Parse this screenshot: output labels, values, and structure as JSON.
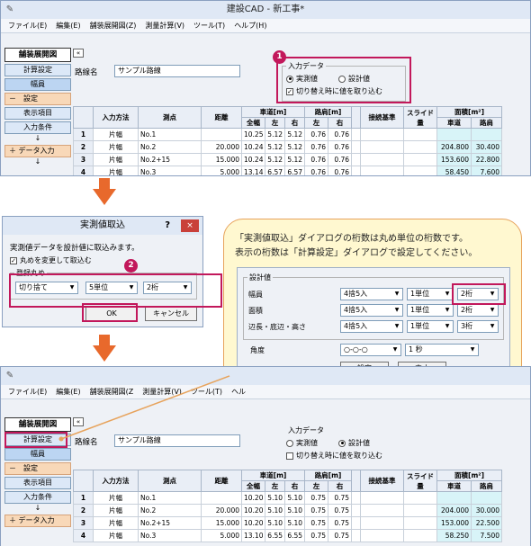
{
  "app": {
    "title": "建設CAD - 新工事*",
    "menus": [
      "ファイル(E)",
      "編集(E)",
      "舗装展開図(Z)",
      "測量計算(V)",
      "ツール(T)",
      "ヘルプ(H)"
    ],
    "bottom_menus": [
      "ファイル(E)",
      "編集(E)",
      "舗装展開図(Z",
      "測量計算(V)",
      "ツール(T)",
      "ヘル"
    ]
  },
  "sidebar": {
    "title": "舗装展開図",
    "items": [
      "計算設定",
      "幅員",
      "－　設定",
      "表示項目",
      "入力条件",
      "↓",
      "＋ データ入力",
      "↓"
    ]
  },
  "form": {
    "road_label": "路線名",
    "road_value": "サンプル路線"
  },
  "input_data_top": {
    "title": "入力データ",
    "opt1": "実測値",
    "opt2": "設計値",
    "checkbox": "切り替え時に値を取り込む",
    "check": "✓"
  },
  "input_data_bottom": {
    "title": "入力データ",
    "opt1": "実測値",
    "opt2": "設計値",
    "checkbox": "切り替え時に値を取り込む",
    "check": ""
  },
  "markers": {
    "one": "1",
    "two": "2"
  },
  "table": {
    "h_method": "入力方法",
    "h_point": "測点",
    "h_dist": "距離",
    "h_road": "車道[m]",
    "h_shoulder": "路肩[m]",
    "h_conn": "接続基準",
    "h_slide": "スライド量",
    "h_area": "面積[m²]",
    "sub": [
      "全幅",
      "左",
      "右",
      "左",
      "右",
      "車道",
      "路肩"
    ]
  },
  "rows_top": [
    {
      "n": "1",
      "m": "片幅",
      "p": "No.1",
      "d": "",
      "w": "10.25",
      "l": "5.12",
      "r": "5.12",
      "sl": "0.76",
      "sr": "0.76",
      "a1": "",
      "a2": ""
    },
    {
      "n": "2",
      "m": "片幅",
      "p": "No.2",
      "d": "20.000",
      "w": "10.24",
      "l": "5.12",
      "r": "5.12",
      "sl": "0.76",
      "sr": "0.76",
      "a1": "204.800",
      "a2": "30.400"
    },
    {
      "n": "3",
      "m": "片幅",
      "p": "No.2+15",
      "d": "15.000",
      "w": "10.24",
      "l": "5.12",
      "r": "5.12",
      "sl": "0.76",
      "sr": "0.76",
      "a1": "153.600",
      "a2": "22.800"
    },
    {
      "n": "4",
      "m": "片幅",
      "p": "No.3",
      "d": "5.000",
      "w": "13.14",
      "l": "6.57",
      "r": "6.57",
      "sl": "0.76",
      "sr": "0.76",
      "a1": "58.450",
      "a2": "7.600"
    }
  ],
  "rows_bottom": [
    {
      "n": "1",
      "m": "片幅",
      "p": "No.1",
      "d": "",
      "w": "10.20",
      "l": "5.10",
      "r": "5.10",
      "sl": "0.75",
      "sr": "0.75",
      "a1": "",
      "a2": ""
    },
    {
      "n": "2",
      "m": "片幅",
      "p": "No.2",
      "d": "20.000",
      "w": "10.20",
      "l": "5.10",
      "r": "5.10",
      "sl": "0.75",
      "sr": "0.75",
      "a1": "204.000",
      "a2": "30.000"
    },
    {
      "n": "3",
      "m": "片幅",
      "p": "No.2+15",
      "d": "15.000",
      "w": "10.20",
      "l": "5.10",
      "r": "5.10",
      "sl": "0.75",
      "sr": "0.75",
      "a1": "153.000",
      "a2": "22.500"
    },
    {
      "n": "4",
      "m": "片幅",
      "p": "No.3",
      "d": "5.000",
      "w": "13.10",
      "l": "6.55",
      "r": "6.55",
      "sl": "0.75",
      "sr": "0.75",
      "a1": "58.250",
      "a2": "7.500"
    }
  ],
  "dialog": {
    "title": "実測値取込",
    "help": "?",
    "close": "×",
    "desc": "実測値データを設計値に取込みます。",
    "check_label": "丸めを変更して取込む",
    "check": "✓",
    "group": "登録丸め",
    "c1": "切り捨て",
    "c2": "5単位",
    "c3": "2桁",
    "ok": "OK",
    "cancel": "キャンセル"
  },
  "callout": {
    "line1": "「実測値取込」ダイアログの桁数は丸め単位の桁数です。",
    "line2": "表示の桁数は「計算設定」ダイアログで設定してください。",
    "group": "設計値",
    "rows": [
      {
        "label": "幅員",
        "a": "4捨5入",
        "b": "1単位",
        "c": "2桁"
      },
      {
        "label": "面積",
        "a": "4捨5入",
        "b": "1単位",
        "c": "2桁"
      },
      {
        "label": "辺長・底辺・高さ",
        "a": "4捨5入",
        "b": "1単位",
        "c": "3桁"
      }
    ],
    "angle_label": "角度",
    "angle_a": "○-○-○",
    "angle_b": "1 秒",
    "setting": "設定",
    "cancel": "中止"
  },
  "colors": {
    "accent": "#c2185b",
    "arrow": "#e8692c",
    "callout_border": "#e7a35c"
  }
}
